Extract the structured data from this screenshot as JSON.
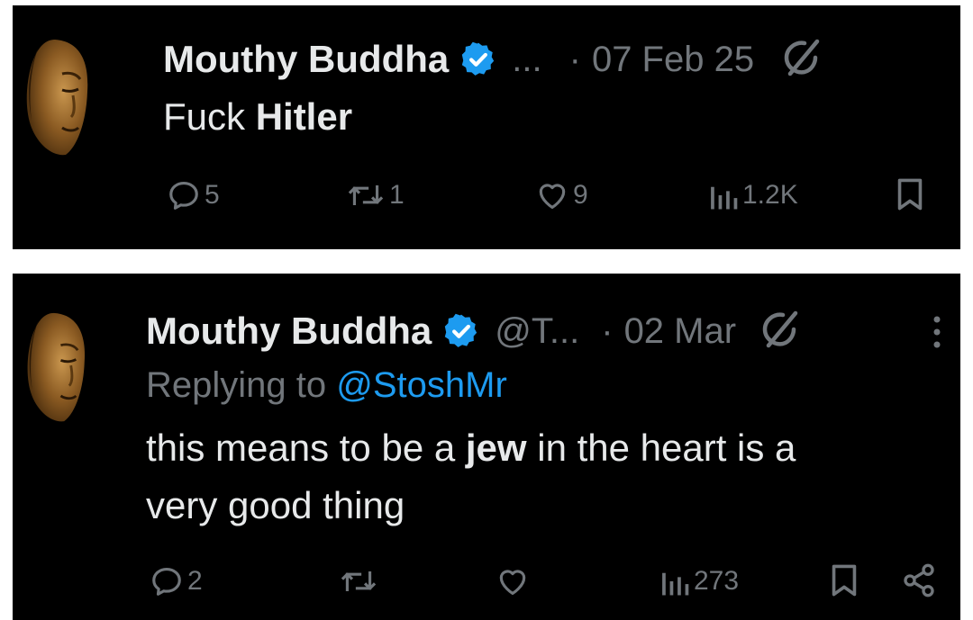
{
  "colors": {
    "background": "#000000",
    "primary_text": "#e7e9ea",
    "secondary_text": "#71767b",
    "link": "#1d9bf0",
    "verified_badge": "#1d9bf0"
  },
  "tweets": [
    {
      "author_name": "Mouthy Buddha",
      "handle": "...",
      "separator": "·",
      "date": "07 Feb 25",
      "text_regular": "Fuck ",
      "text_bold": "Hitler",
      "actions": {
        "replies": "5",
        "reposts": "1",
        "likes": "9",
        "views": "1.2K"
      }
    },
    {
      "author_name": "Mouthy Buddha",
      "handle": "@T...",
      "separator": "·",
      "date": "02 Mar",
      "replying_prefix": "Replying to ",
      "replying_mention": "@StoshMr",
      "text_line1_before": "this means to be a ",
      "text_line1_bold": "jew",
      "text_line1_after": " in the heart is a",
      "text_line2": "very good thing",
      "actions": {
        "replies": "2",
        "views": "273"
      }
    }
  ]
}
